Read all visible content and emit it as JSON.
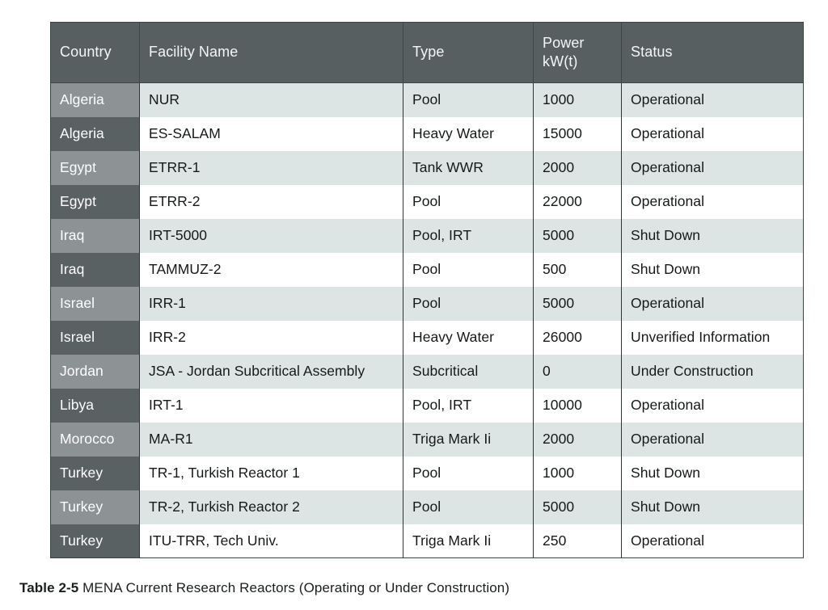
{
  "table": {
    "columns": [
      {
        "key": "country",
        "label": "Country"
      },
      {
        "key": "facility",
        "label": "Facility Name"
      },
      {
        "key": "type",
        "label": "Type"
      },
      {
        "key": "power",
        "label_line1": "Power",
        "label_line2": "kW(t)"
      },
      {
        "key": "status",
        "label": "Status"
      }
    ],
    "rows": [
      {
        "country": "Algeria",
        "facility": "NUR",
        "type": "Pool",
        "power": "1000",
        "status": "Operational"
      },
      {
        "country": "Algeria",
        "facility": "ES-SALAM",
        "type": "Heavy Water",
        "power": "15000",
        "status": "Operational"
      },
      {
        "country": "Egypt",
        "facility": "ETRR-1",
        "type": "Tank WWR",
        "power": "2000",
        "status": "Operational"
      },
      {
        "country": "Egypt",
        "facility": "ETRR-2",
        "type": "Pool",
        "power": "22000",
        "status": "Operational"
      },
      {
        "country": "Iraq",
        "facility": "IRT-5000",
        "type": "Pool, IRT",
        "power": "5000",
        "status": "Shut Down"
      },
      {
        "country": "Iraq",
        "facility": "TAMMUZ-2",
        "type": "Pool",
        "power": "500",
        "status": "Shut Down"
      },
      {
        "country": "Israel",
        "facility": "IRR-1",
        "type": "Pool",
        "power": "5000",
        "status": "Operational"
      },
      {
        "country": "Israel",
        "facility": "IRR-2",
        "type": "Heavy Water",
        "power": "26000",
        "status": "Unverified Information"
      },
      {
        "country": "Jordan",
        "facility": "JSA - Jordan Subcritical Assembly",
        "type": "Subcritical",
        "power": "0",
        "status": "Under Construction"
      },
      {
        "country": "Libya",
        "facility": "IRT-1",
        "type": "Pool, IRT",
        "power": "10000",
        "status": "Operational"
      },
      {
        "country": "Morocco",
        "facility": "MA-R1",
        "type": "Triga Mark Ii",
        "power": "2000",
        "status": "Operational"
      },
      {
        "country": "Turkey",
        "facility": "TR-1, Turkish Reactor 1",
        "type": "Pool",
        "power": "1000",
        "status": "Shut Down"
      },
      {
        "country": "Turkey",
        "facility": "TR-2, Turkish Reactor 2",
        "type": "Pool",
        "power": "5000",
        "status": "Shut Down"
      },
      {
        "country": "Turkey",
        "facility": "ITU-TRR, Tech Univ.",
        "type": "Triga Mark Ii",
        "power": "250",
        "status": "Operational"
      }
    ]
  },
  "caption": {
    "label": "Table 2-5",
    "text": "MENA Current Research Reactors (Operating or Under Construction)"
  },
  "colors": {
    "header_fill": "#575f61",
    "header_text": "#f4f6f6",
    "row_shade": "#dde4e4",
    "row_plain": "#ffffff",
    "country_light": "#8d9395",
    "country_dark": "#5a6162",
    "grid_line": "#2f3537",
    "body_text": "#16191a"
  }
}
